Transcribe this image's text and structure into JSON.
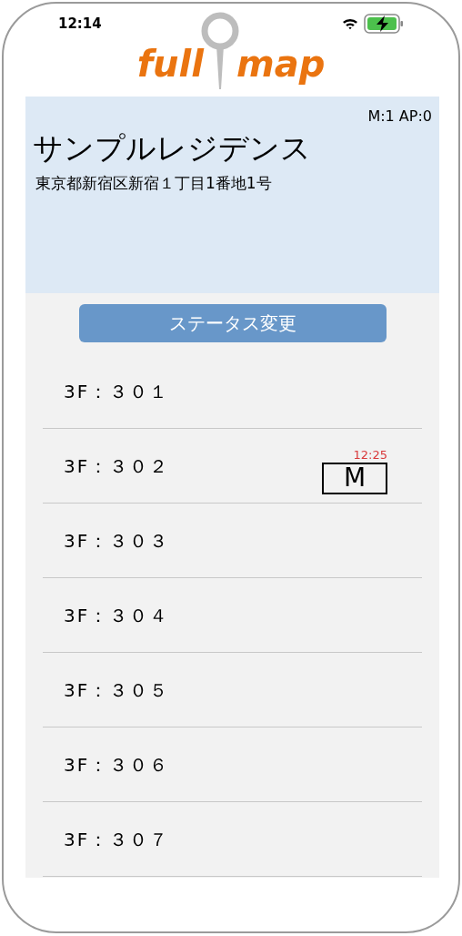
{
  "status_bar": {
    "time": "12:14"
  },
  "logo": {
    "left": "full",
    "right": "map"
  },
  "property": {
    "counts": "M:1 AP:0",
    "name": "サンプルレジデンス",
    "address": "東京都新宿区新宿１丁目1番地1号"
  },
  "status_button": "ステータス変更",
  "rooms": [
    {
      "label": "3F：３０１"
    },
    {
      "label": "3F：３０２",
      "badge": {
        "time": "12:25",
        "letter": "M"
      }
    },
    {
      "label": "3F：３０３"
    },
    {
      "label": "3F：３０４"
    },
    {
      "label": "3F：３０５"
    },
    {
      "label": "3F：３０６"
    },
    {
      "label": "3F：３０７"
    }
  ]
}
